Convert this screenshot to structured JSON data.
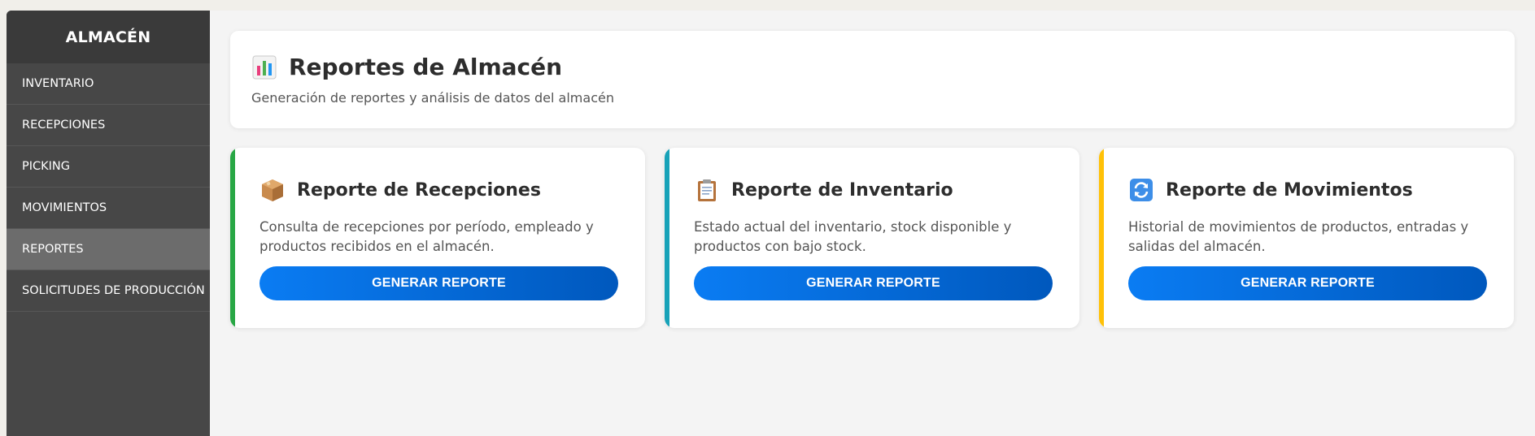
{
  "sidebar": {
    "title": "ALMACÉN",
    "items": [
      {
        "label": "INVENTARIO"
      },
      {
        "label": "RECEPCIONES"
      },
      {
        "label": "PICKING"
      },
      {
        "label": "MOVIMIENTOS"
      },
      {
        "label": "REPORTES"
      },
      {
        "label": "SOLICITUDES DE PRODUCCIÓN"
      }
    ],
    "active_item": "REPORTES"
  },
  "header": {
    "icon": "bar-chart-icon",
    "title": "Reportes de Almacén",
    "subtitle": "Generación de reportes y análisis de datos del almacén"
  },
  "cards": [
    {
      "icon": "package-icon",
      "title": "Reporte de Recepciones",
      "description": "Consulta de recepciones por período, empleado y productos recibidos en el almacén.",
      "button_label": "GENERAR REPORTE",
      "accent_color": "#28a745"
    },
    {
      "icon": "clipboard-icon",
      "title": "Reporte de Inventario",
      "description": "Estado actual del inventario, stock disponible y productos con bajo stock.",
      "button_label": "GENERAR REPORTE",
      "accent_color": "#17a2b8"
    },
    {
      "icon": "refresh-icon",
      "title": "Reporte de Movimientos",
      "description": "Historial de movimientos de productos, entradas y salidas del almacén.",
      "button_label": "GENERAR REPORTE",
      "accent_color": "#ffc107"
    }
  ],
  "colors": {
    "sidebar_bg": "#474747",
    "sidebar_active": "#6c6c6c",
    "button_gradient_start": "#0a7cf3",
    "button_gradient_end": "#0058bd"
  }
}
